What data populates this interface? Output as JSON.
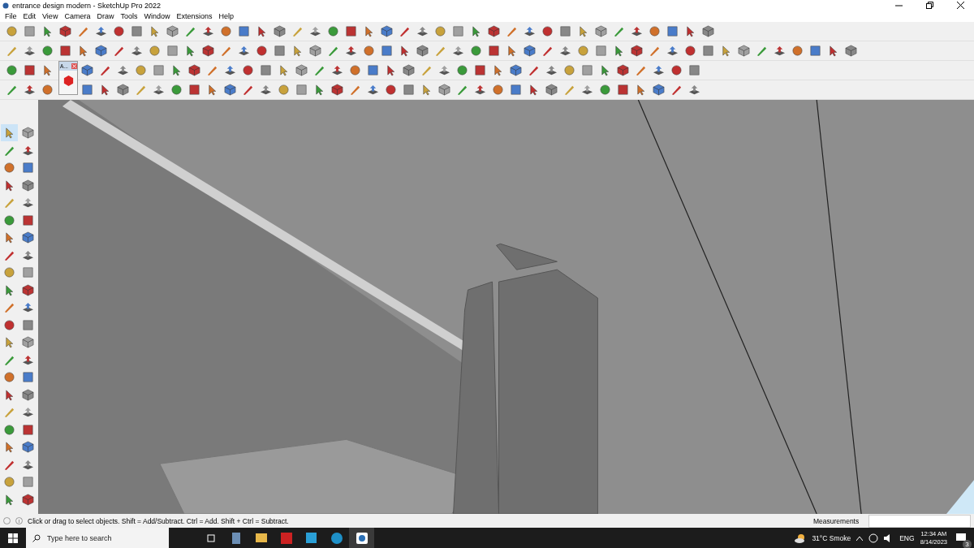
{
  "window": {
    "title": "entrance design modern - SketchUp Pro 2022"
  },
  "menu": [
    "File",
    "Edit",
    "View",
    "Camera",
    "Draw",
    "Tools",
    "Window",
    "Extensions",
    "Help"
  ],
  "floating_toolbar": {
    "title": "A..."
  },
  "status_bar": {
    "hint": "Click or drag to select objects. Shift = Add/Subtract. Ctrl = Add. Shift + Ctrl = Subtract.",
    "measurements_label": "Measurements"
  },
  "taskbar": {
    "search": {
      "placeholder": "Type here to search"
    },
    "weather": "31°C Smoke",
    "language": "ENG",
    "time": "12:34 AM",
    "date": "8/14/2023",
    "notifications": "3"
  }
}
